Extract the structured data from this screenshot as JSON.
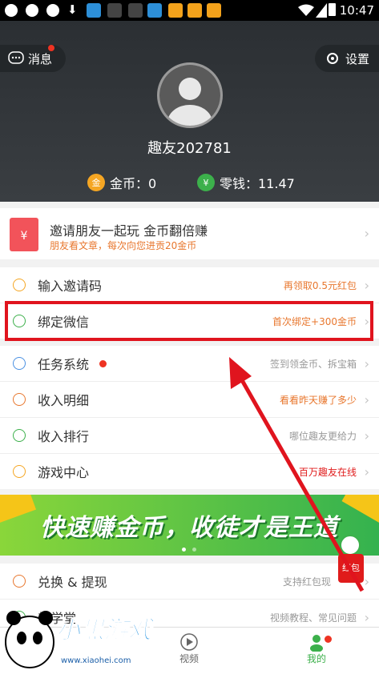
{
  "status": {
    "time": "10:47"
  },
  "header": {
    "messages_label": "消息",
    "settings_label": "设置",
    "username": "趣友202781",
    "gold_label": "金币：0",
    "change_label": "零钱：11.47"
  },
  "invite": {
    "title": "邀请朋友一起玩 金币翻倍赚",
    "subtitle": "朋友看文章，每次向您进贡20金币"
  },
  "menu1": [
    {
      "label": "输入邀请码",
      "right": "再领取0.5元红包",
      "color": "#e8772e"
    },
    {
      "label": "绑定微信",
      "right": "首次绑定+300金币",
      "color": "#e8772e"
    }
  ],
  "menu2": [
    {
      "label": "任务系统",
      "right": "签到领金币、拆宝箱",
      "color": "#999999"
    },
    {
      "label": "收入明细",
      "right": "看看昨天赚了多少",
      "color": "#e8772e"
    },
    {
      "label": "收入排行",
      "right": "哪位趣友更给力",
      "color": "#999999"
    },
    {
      "label": "游戏中心",
      "right": "百万趣友在线",
      "color": "#e01b1b"
    }
  ],
  "banner": {
    "text": "快速赚金币，收徒才是王道"
  },
  "menu3": [
    {
      "label": "兑换 & 提现",
      "right": "支持红包现",
      "color": "#999999"
    },
    {
      "label": "趣学堂",
      "right": "视频教程、常见问题",
      "color": "#999999"
    }
  ],
  "redpacket_label": "红包",
  "tabs": {
    "video": "视频",
    "mine": "我的"
  },
  "watermark": {
    "text": "小黑游戏",
    "url": "www.xiaohei.com"
  }
}
